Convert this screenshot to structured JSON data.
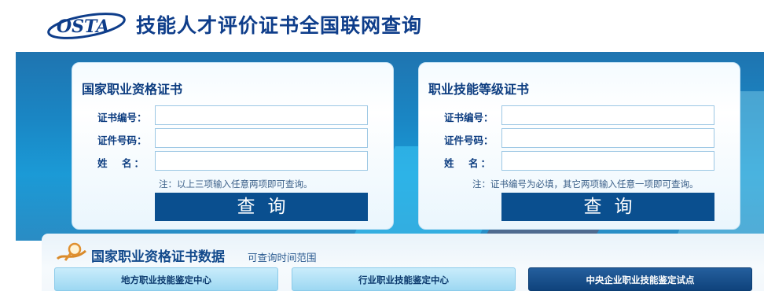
{
  "header": {
    "logo_text": "OSTA",
    "title": "技能人才评价证书全国联网查询"
  },
  "cards": {
    "left": {
      "title": "国家职业资格证书",
      "label_cert_no": "证书编号：",
      "label_id_no": "证件号码：",
      "label_name": "姓　名：",
      "note": "注：以上三项输入任意两项即可查询。",
      "button": "查询"
    },
    "right": {
      "title": "职业技能等级证书",
      "label_cert_no": "证书编号：",
      "label_id_no": "证件号码：",
      "label_name": "姓　名：",
      "note": "注：证书编号为必填，其它两项输入任意一项即可查询。",
      "button": "查询"
    }
  },
  "data_section": {
    "title": "国家职业资格证书数据",
    "subtitle": "可查询时间范围",
    "tabs": [
      {
        "label": "地方职业技能鉴定中心",
        "active": false
      },
      {
        "label": "行业职业技能鉴定中心",
        "active": false
      },
      {
        "label": "中央企业职业技能鉴定试点",
        "active": true
      }
    ]
  },
  "colors": {
    "brand_blue": "#0e3d8a",
    "button_blue": "#0a4f8f",
    "banner_blue": "#1a86c4"
  },
  "icons": {
    "logo": "osta-logo",
    "data_section": "magnifier-ribbon-icon"
  }
}
